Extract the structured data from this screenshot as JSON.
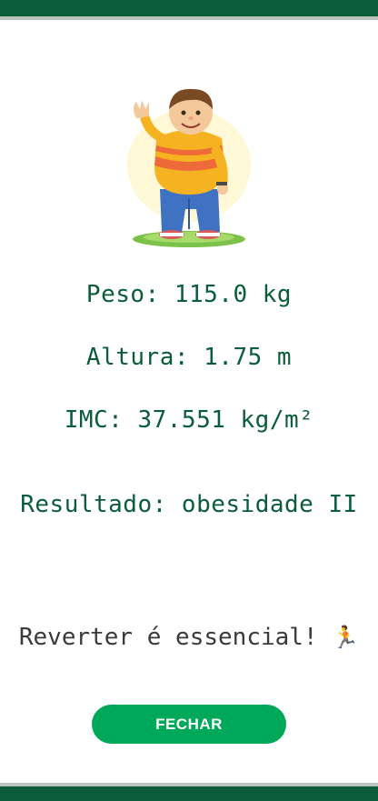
{
  "colors": {
    "primary": "#0a5c3b",
    "button": "#00a859",
    "button_text": "#ffffff",
    "motto_text": "#3a3a3a"
  },
  "illustration": {
    "icon": "waving-man-character-icon"
  },
  "info": {
    "weight": "Peso: 115.0 kg",
    "height": "Altura: 1.75 m",
    "bmi": "IMC: 37.551 kg/m²"
  },
  "result": "Resultado: obesidade II",
  "motto": {
    "text": "Reverter é essencial! ",
    "emoji": "🏃"
  },
  "button": {
    "label": "FECHAR"
  }
}
